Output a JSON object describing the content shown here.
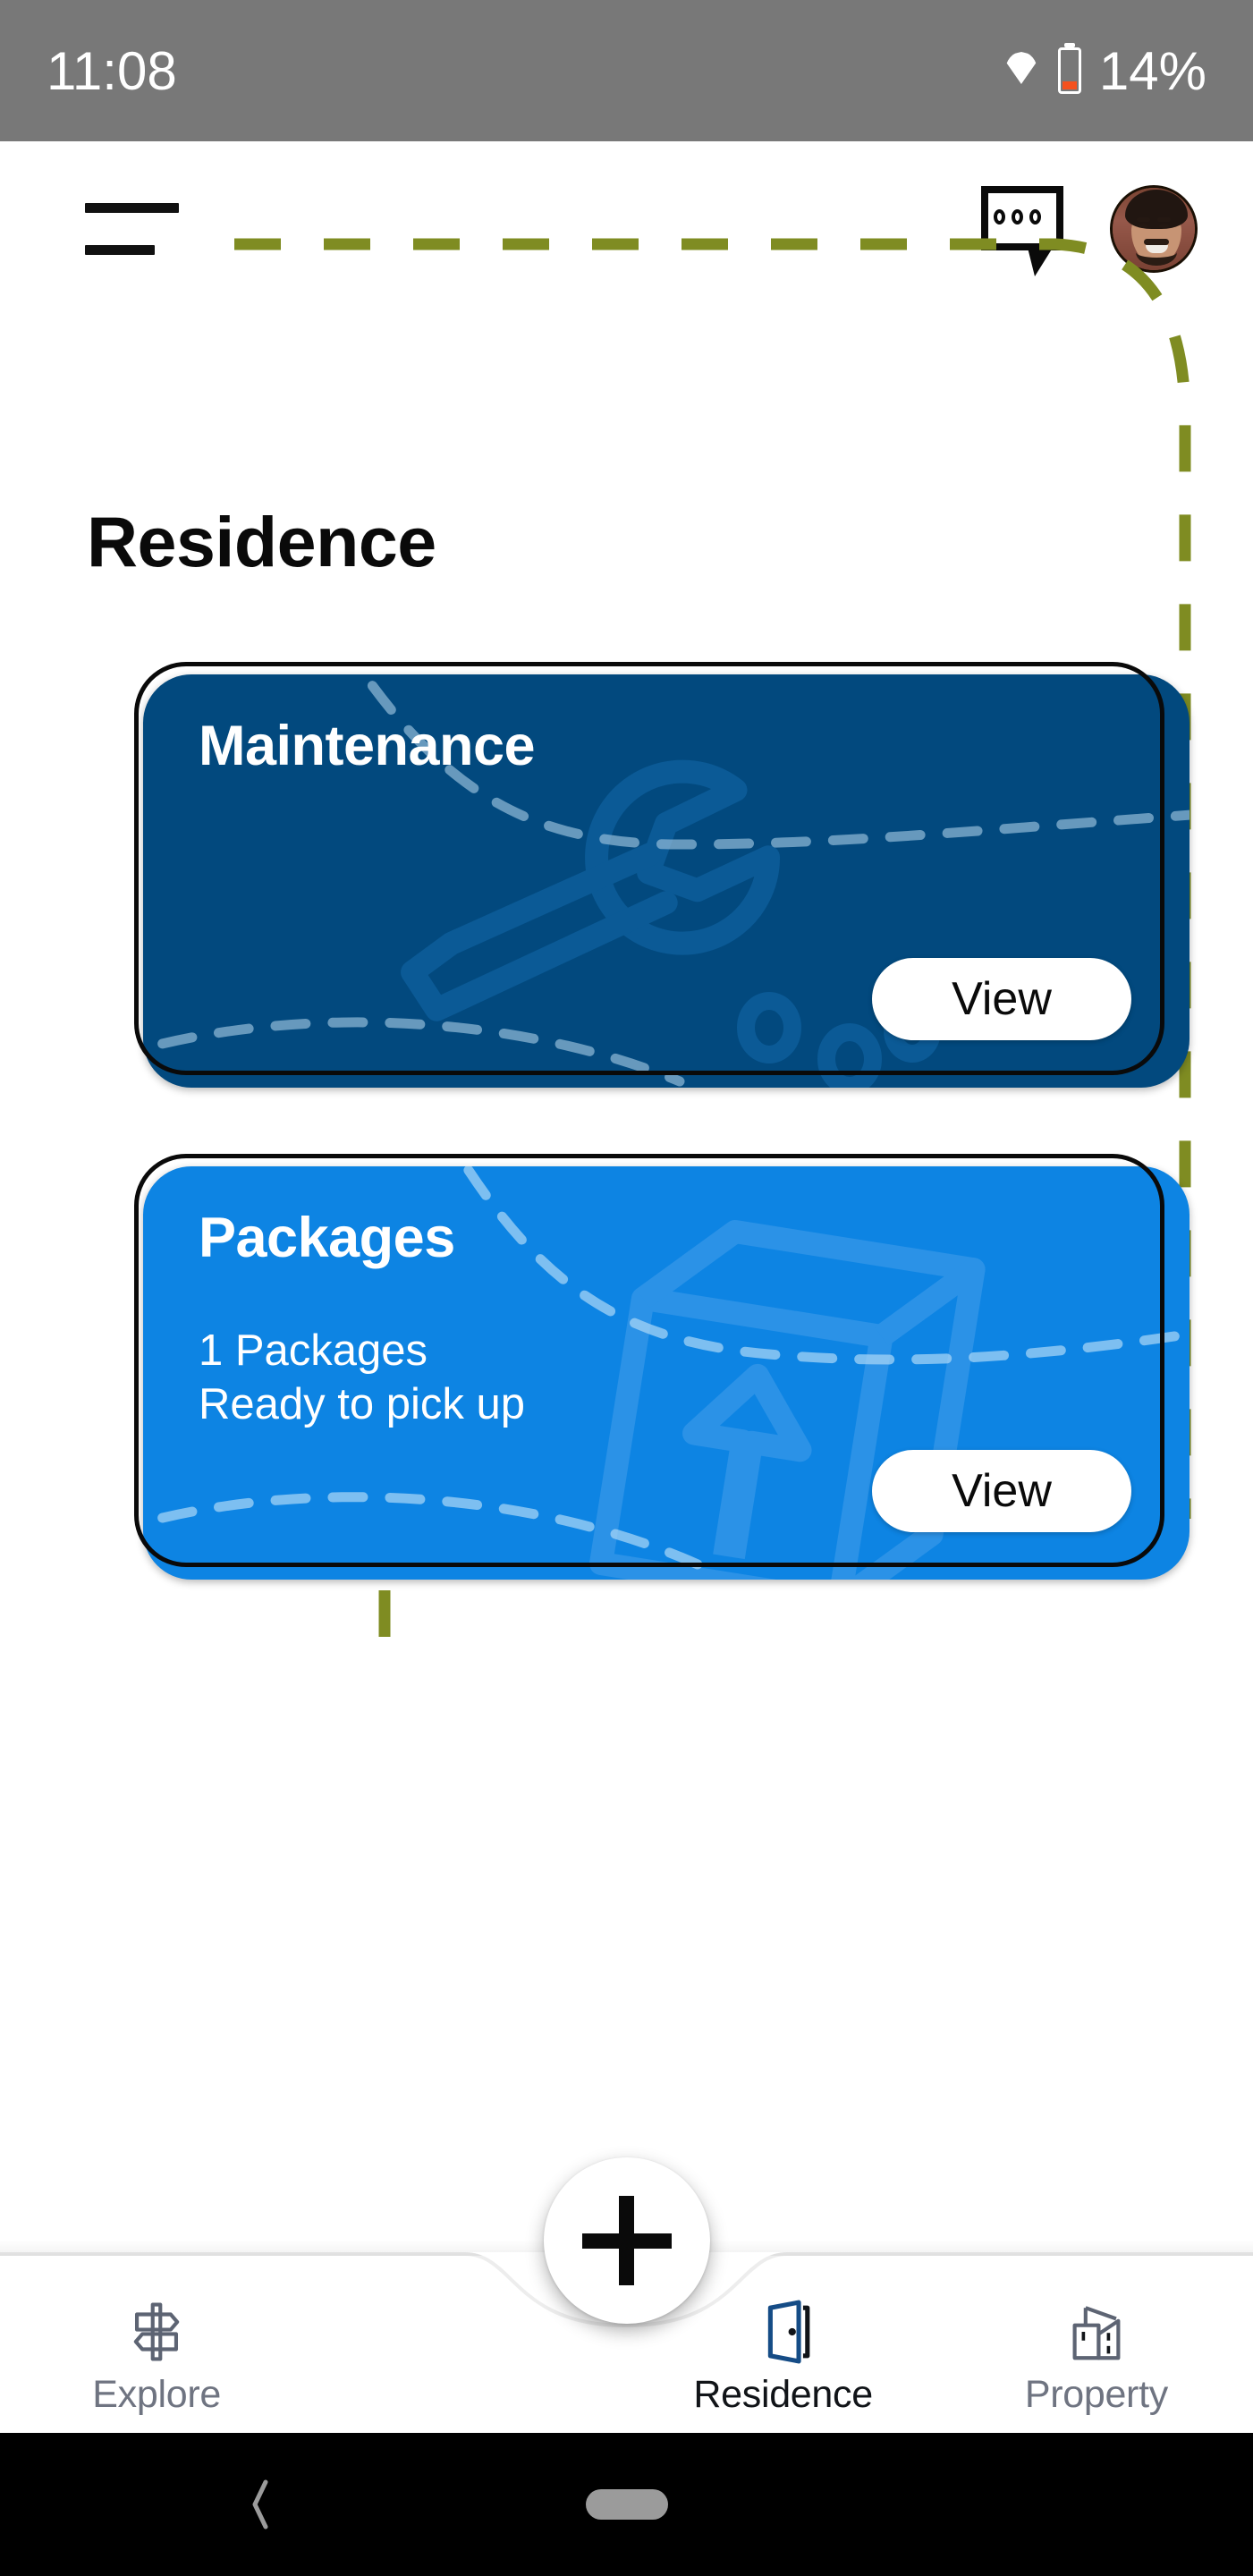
{
  "status_bar": {
    "time": "11:08",
    "battery_percent": "14%",
    "wifi_icon": "wifi-icon",
    "battery_icon": "battery-low-icon",
    "background_color": "#787878",
    "text_color": "#ffffff"
  },
  "header": {
    "menu_icon": "hamburger-menu-icon",
    "chat_icon": "chat-bubble-icon",
    "avatar_icon": "user-avatar"
  },
  "main": {
    "page_title": "Residence",
    "guide_line_color": "#7f8c22",
    "cards": [
      {
        "title": "Maintenance",
        "lines": [],
        "action_label": "View",
        "background_color": "#02497e",
        "watermark_icon": "wrench-icon"
      },
      {
        "title": "Packages",
        "lines": [
          "1 Packages",
          "Ready to pick up"
        ],
        "action_label": "View",
        "background_color": "#0d84e3",
        "watermark_icon": "package-box-icon"
      }
    ]
  },
  "bottom_nav": {
    "fab_label": "+",
    "fab_icon": "plus-icon",
    "items": [
      {
        "label": "Explore",
        "icon": "signpost-icon",
        "active": false
      },
      {
        "label": "Residence",
        "icon": "open-door-icon",
        "active": true
      },
      {
        "label": "Property",
        "icon": "buildings-icon",
        "active": false
      }
    ],
    "active_color": "#111418",
    "inactive_color": "#6f7481"
  },
  "android_nav": {
    "back_icon": "back-chevron-icon",
    "home_icon": "home-pill-indicator",
    "background_color": "#000000"
  }
}
